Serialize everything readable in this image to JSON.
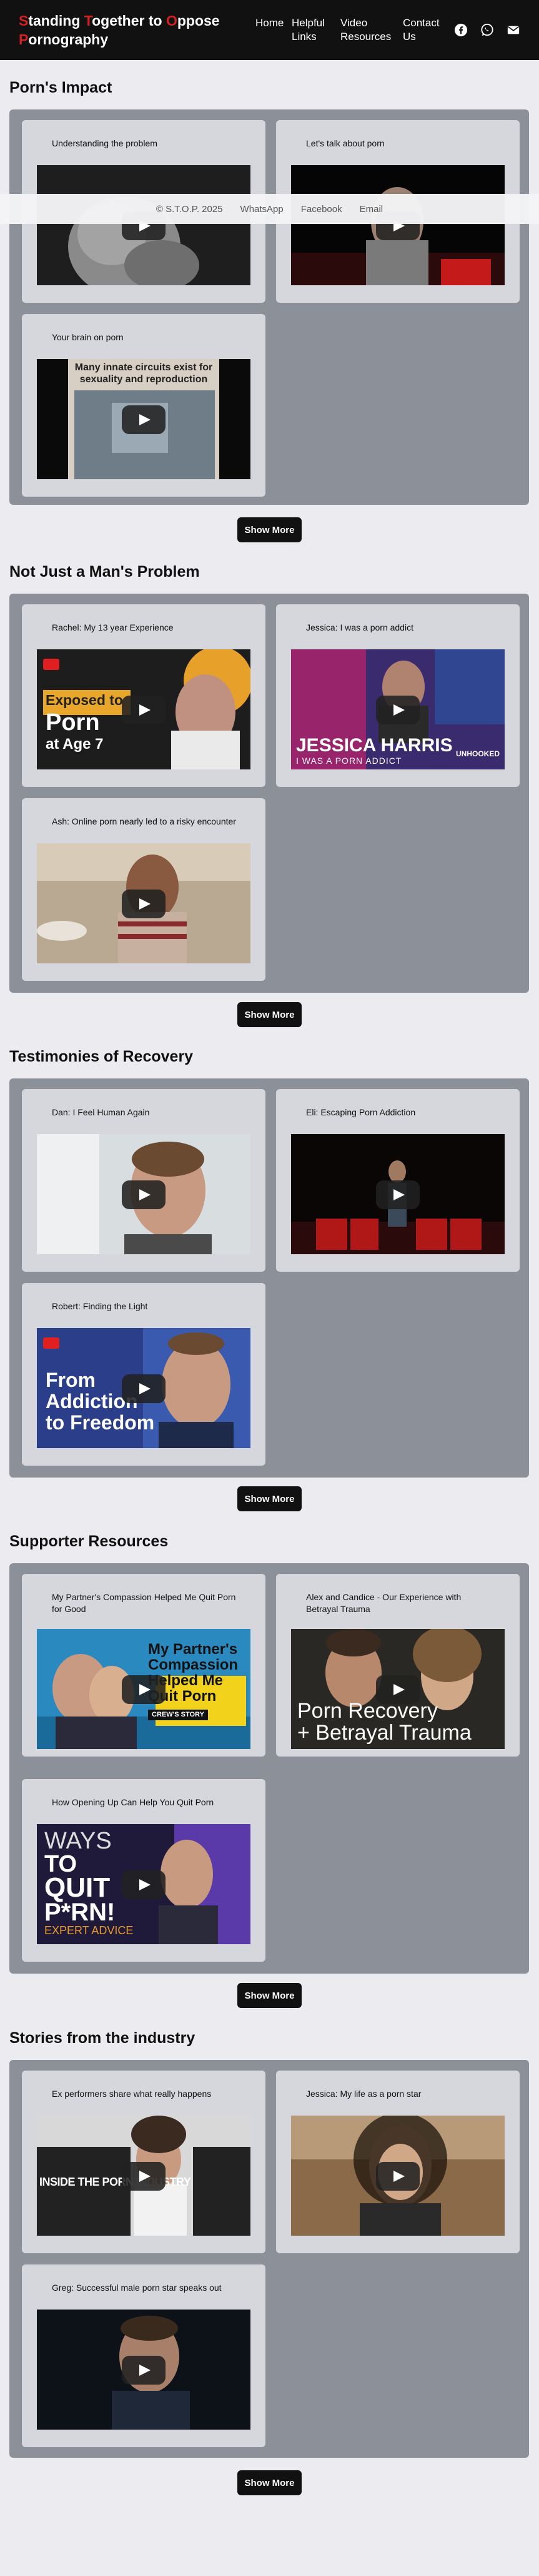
{
  "header": {
    "brand_words": [
      {
        "cap": "S",
        "rest": "tanding "
      },
      {
        "cap": "T",
        "rest": "ogether to "
      },
      {
        "cap": "O",
        "rest": "ppose "
      },
      {
        "cap": "P",
        "rest": "ornography"
      }
    ],
    "nav": [
      "Home",
      "Helpful Links",
      "Video Resources",
      "Contact Us"
    ],
    "social_icons": [
      "facebook-icon",
      "whatsapp-icon",
      "email-icon"
    ]
  },
  "footer": {
    "copyright": "© S.T.O.P. 2025",
    "links": [
      "WhatsApp",
      "Facebook",
      "Email"
    ]
  },
  "sections": [
    {
      "title": "Porn's Impact",
      "show_more": "Show More",
      "videos": [
        {
          "title": "Understanding the problem"
        },
        {
          "title": "Let's talk about porn"
        },
        {
          "title": "Your brain on porn",
          "overlay_text": "Many innate circuits exist for sexuality and reproduction"
        }
      ]
    },
    {
      "title": "Not Just a Man's Problem",
      "show_more": "Show More",
      "videos": [
        {
          "title": "Rachel: My 13 year Experience",
          "overlay_text": [
            "Exposed to",
            "Porn",
            "at Age 7"
          ]
        },
        {
          "title": "Jessica: I was a porn addict",
          "overlay_text": [
            "JESSICA HARRIS",
            "I WAS A PORN ADDICT",
            "UNHOOKED"
          ]
        },
        {
          "title": "Ash: Online porn nearly led to a risky encounter"
        }
      ]
    },
    {
      "title": "Testimonies of Recovery",
      "show_more": "Show More",
      "videos": [
        {
          "title": "Dan: I Feel Human Again"
        },
        {
          "title": "Eli: Escaping Porn Addiction"
        },
        {
          "title": "Robert: Finding the Light",
          "overlay_text": [
            "From",
            "Addiction",
            "to Freedom"
          ]
        }
      ]
    },
    {
      "title": "Supporter Resources",
      "show_more": "Show More",
      "videos": [
        {
          "title": "My Partner's Compassion Helped Me Quit Porn for Good",
          "overlay_text": [
            "My Partner's",
            "Compassion",
            "Helped Me",
            "Quit Porn",
            "CREW'S STORY"
          ]
        },
        {
          "title": "Alex and Candice - Our Experience with Betrayal Trauma",
          "overlay_text": [
            "Porn Recovery",
            "+ Betrayal Trauma"
          ]
        },
        {
          "title": "How Opening Up Can Help You Quit Porn",
          "overlay_text": [
            "WAYS",
            "TO",
            "QUIT",
            "P*RN!",
            "EXPERT ADVICE"
          ]
        }
      ]
    },
    {
      "title": "Stories from the industry",
      "show_more": "Show More",
      "videos": [
        {
          "title": "Ex performers share what really happens",
          "overlay_text": [
            "INSIDE THE PORN INDUSTRY"
          ]
        },
        {
          "title": "Jessica: My life as a porn star"
        },
        {
          "title": "Greg: Successful male porn star speaks out"
        }
      ]
    }
  ]
}
